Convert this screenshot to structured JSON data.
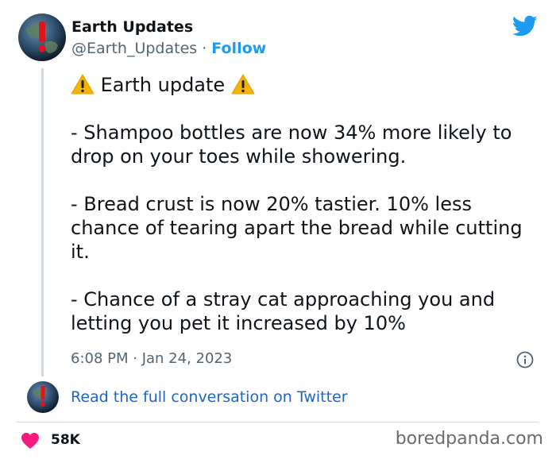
{
  "author": {
    "name": "Earth Updates",
    "handle": "@Earth_Updates",
    "separator": " · ",
    "follow_label": "Follow"
  },
  "tweet": {
    "header": "Earth update",
    "paragraphs": [
      "- Shampoo bottles are now 34% more likely to drop on your toes while showering.",
      "- Bread crust is now 20% tastier. 10% less chance of tearing apart the bread while cutting it.",
      "- Chance of a stray cat approaching you and letting you pet it increased by 10%"
    ],
    "timestamp": "6:08 PM · Jan 24, 2023"
  },
  "read_link": "Read the full conversation on Twitter",
  "likes": "58K",
  "watermark": "boredpanda.com",
  "colors": {
    "link": "#1d9bf0",
    "heart": "#f91880",
    "twitter_logo": "#1d9bf0",
    "warning": "#f4b400"
  },
  "icons": [
    "twitter-bird-icon",
    "warning-icon",
    "info-icon",
    "heart-icon"
  ]
}
